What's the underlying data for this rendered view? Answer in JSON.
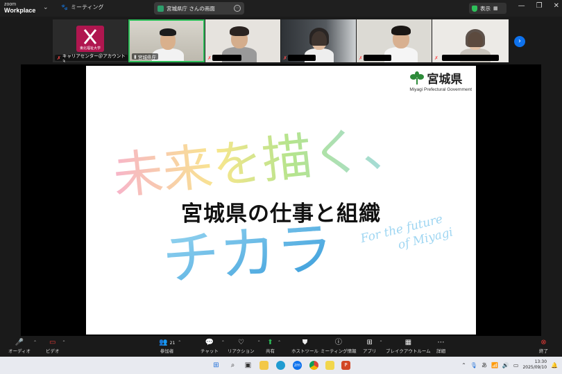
{
  "app": {
    "logo_line1": "zoom",
    "logo_line2": "Workplace"
  },
  "titlebar": {
    "meeting_tab": "ミーティング",
    "share_tab": "宮城県庁 さんの画面",
    "view_label": "表示"
  },
  "participants": [
    {
      "name": "キャリアセンター＠アカウント3",
      "logo_text": "東北福祉大学"
    },
    {
      "name": "宮城県庁"
    },
    {
      "name": ""
    },
    {
      "name": ""
    },
    {
      "name": ""
    },
    {
      "name": ""
    }
  ],
  "slide": {
    "logo_name": "宮城県",
    "logo_en": "Miyagi Prefectural Government",
    "title": "宮城県の仕事と組織",
    "deco_jp_1": "未来を描く、",
    "deco_jp_2": "チカラ",
    "deco_en_1": "For the future",
    "deco_en_2": "of Miyagi"
  },
  "toolbar": {
    "audio": "オーディオ",
    "video": "ビデオ",
    "participants": "参加者",
    "participant_count": "21",
    "chat": "チャット",
    "reactions": "リアクション",
    "share": "共有",
    "host_tools": "ホストツール",
    "meeting_info": "ミーティング情報",
    "apps": "アプリ",
    "breakout": "ブレイクアウトルーム",
    "more": "詳細",
    "end": "終了"
  },
  "taskbar": {
    "ime": "あ",
    "time": "13:30",
    "date": "2025/09/10"
  },
  "colors": {
    "accent": "#0e72ed",
    "share_green": "#2ec05a",
    "end_red": "#e53935",
    "deco_blue": "#3fa9e0"
  }
}
